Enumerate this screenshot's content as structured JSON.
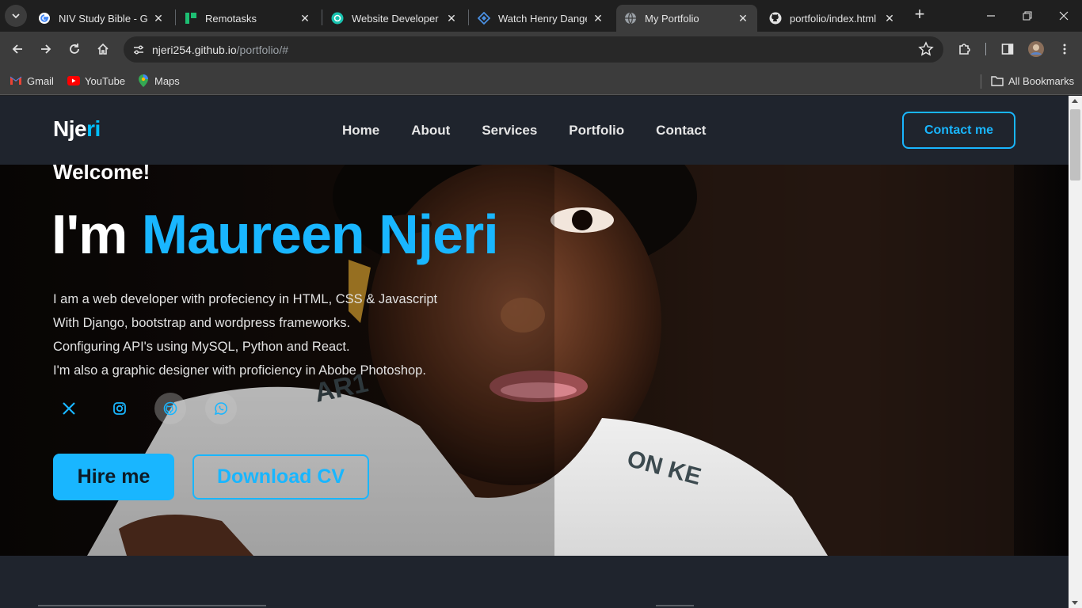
{
  "browser": {
    "tabs": [
      {
        "title": "NIV Study Bible - Goo",
        "icon": "google-icon",
        "active": false
      },
      {
        "title": "Remotasks",
        "icon": "remotasks-icon",
        "active": false
      },
      {
        "title": "Website Developer / I",
        "icon": "chatgpt-icon",
        "active": false
      },
      {
        "title": "Watch Henry Danger",
        "icon": "stream-icon",
        "active": false
      },
      {
        "title": "My Portfolio",
        "icon": "globe-icon",
        "active": true
      },
      {
        "title": "portfolio/index.html a",
        "icon": "github-icon",
        "active": false
      }
    ],
    "url_host": "njeri254.github.io",
    "url_path": "/portfolio/#",
    "bookmarks": [
      {
        "label": "Gmail",
        "icon": "gmail-icon"
      },
      {
        "label": "YouTube",
        "icon": "youtube-icon"
      },
      {
        "label": "Maps",
        "icon": "maps-icon"
      }
    ],
    "all_bookmarks": "All Bookmarks"
  },
  "site": {
    "logo_main": "Nje",
    "logo_accent": "ri",
    "nav": [
      "Home",
      "About",
      "Services",
      "Portfolio",
      "Contact"
    ],
    "contact_button": "Contact me",
    "hero": {
      "welcome": "Welcome!",
      "im": "I'm ",
      "name": "Maureen Njeri",
      "lines": [
        "I am a web developer with profeciency in HTML, CSS & Javascript",
        "With Django, bootstrap and wordpress frameworks.",
        "Configuring API's using MySQL, Python and React.",
        "I'm also a graphic designer with proficiency in Abobe Photoshop."
      ],
      "socials": [
        "x-icon",
        "instagram-icon",
        "github-icon",
        "whatsapp-icon"
      ],
      "hire_button": "Hire me",
      "cv_button": "Download CV"
    }
  },
  "colors": {
    "accent": "#19b6ff",
    "page_bg": "#1f242d",
    "chrome_bg": "#3c3c3c"
  }
}
